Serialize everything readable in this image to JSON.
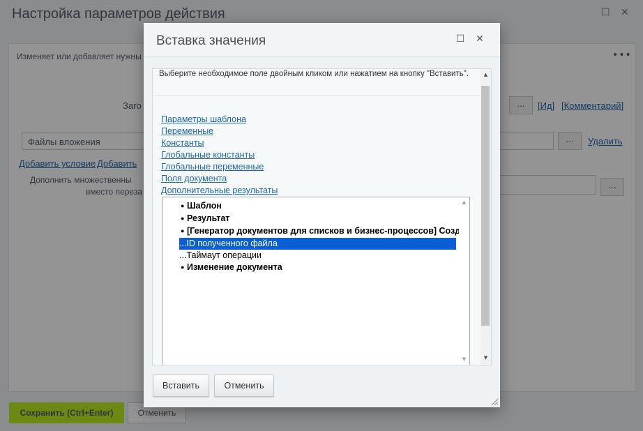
{
  "background": {
    "window_title": "Настройка параметров действия",
    "description_text": "Изменяет или добавляет нужны",
    "label_header": "Заго",
    "field_value": "Файлы вложения",
    "link_id": "[Ид]",
    "link_comment": "[Комментарий]",
    "link_delete": "Удалить",
    "link_add_condition": "Добавить условие",
    "link_add_partial": "Добавить",
    "label_append_1": "Дополнить множественны",
    "label_append_2": "вместо переза",
    "dots": "...",
    "save_label": "Сохранить (Ctrl+Enter)",
    "cancel_label": "Отменить"
  },
  "dialog": {
    "title": "Вставка значения",
    "instruction": "Выберите необходимое поле двойным кликом или нажатием на кнопку \"Вставить\".",
    "links": [
      {
        "label": "Параметры шаблона"
      },
      {
        "label": "Переменные"
      },
      {
        "label": "Константы"
      },
      {
        "label": "Глобальные константы"
      },
      {
        "label": "Глобальные переменные"
      },
      {
        "label": "Поля документа"
      },
      {
        "label": "Дополнительные результаты"
      }
    ],
    "tree": [
      {
        "label": "Шаблон",
        "bold": true,
        "bullet": true,
        "selected": false
      },
      {
        "label": "Результат",
        "bold": true,
        "bullet": true,
        "selected": false
      },
      {
        "label": "[Генератор документов для списков и бизнес-процессов] Создание документа",
        "bold": true,
        "bullet": true,
        "selected": false
      },
      {
        "label": "...ID полученного файла",
        "bold": false,
        "bullet": false,
        "selected": true
      },
      {
        "label": "...Таймаут операции",
        "bold": false,
        "bullet": false,
        "selected": false
      },
      {
        "label": "Изменение документа",
        "bold": true,
        "bullet": true,
        "selected": false
      }
    ],
    "insert_label": "Вставить",
    "cancel_label": "Отменить",
    "colors": {
      "selection": "#0b5fd6",
      "link": "#2067b0"
    }
  }
}
